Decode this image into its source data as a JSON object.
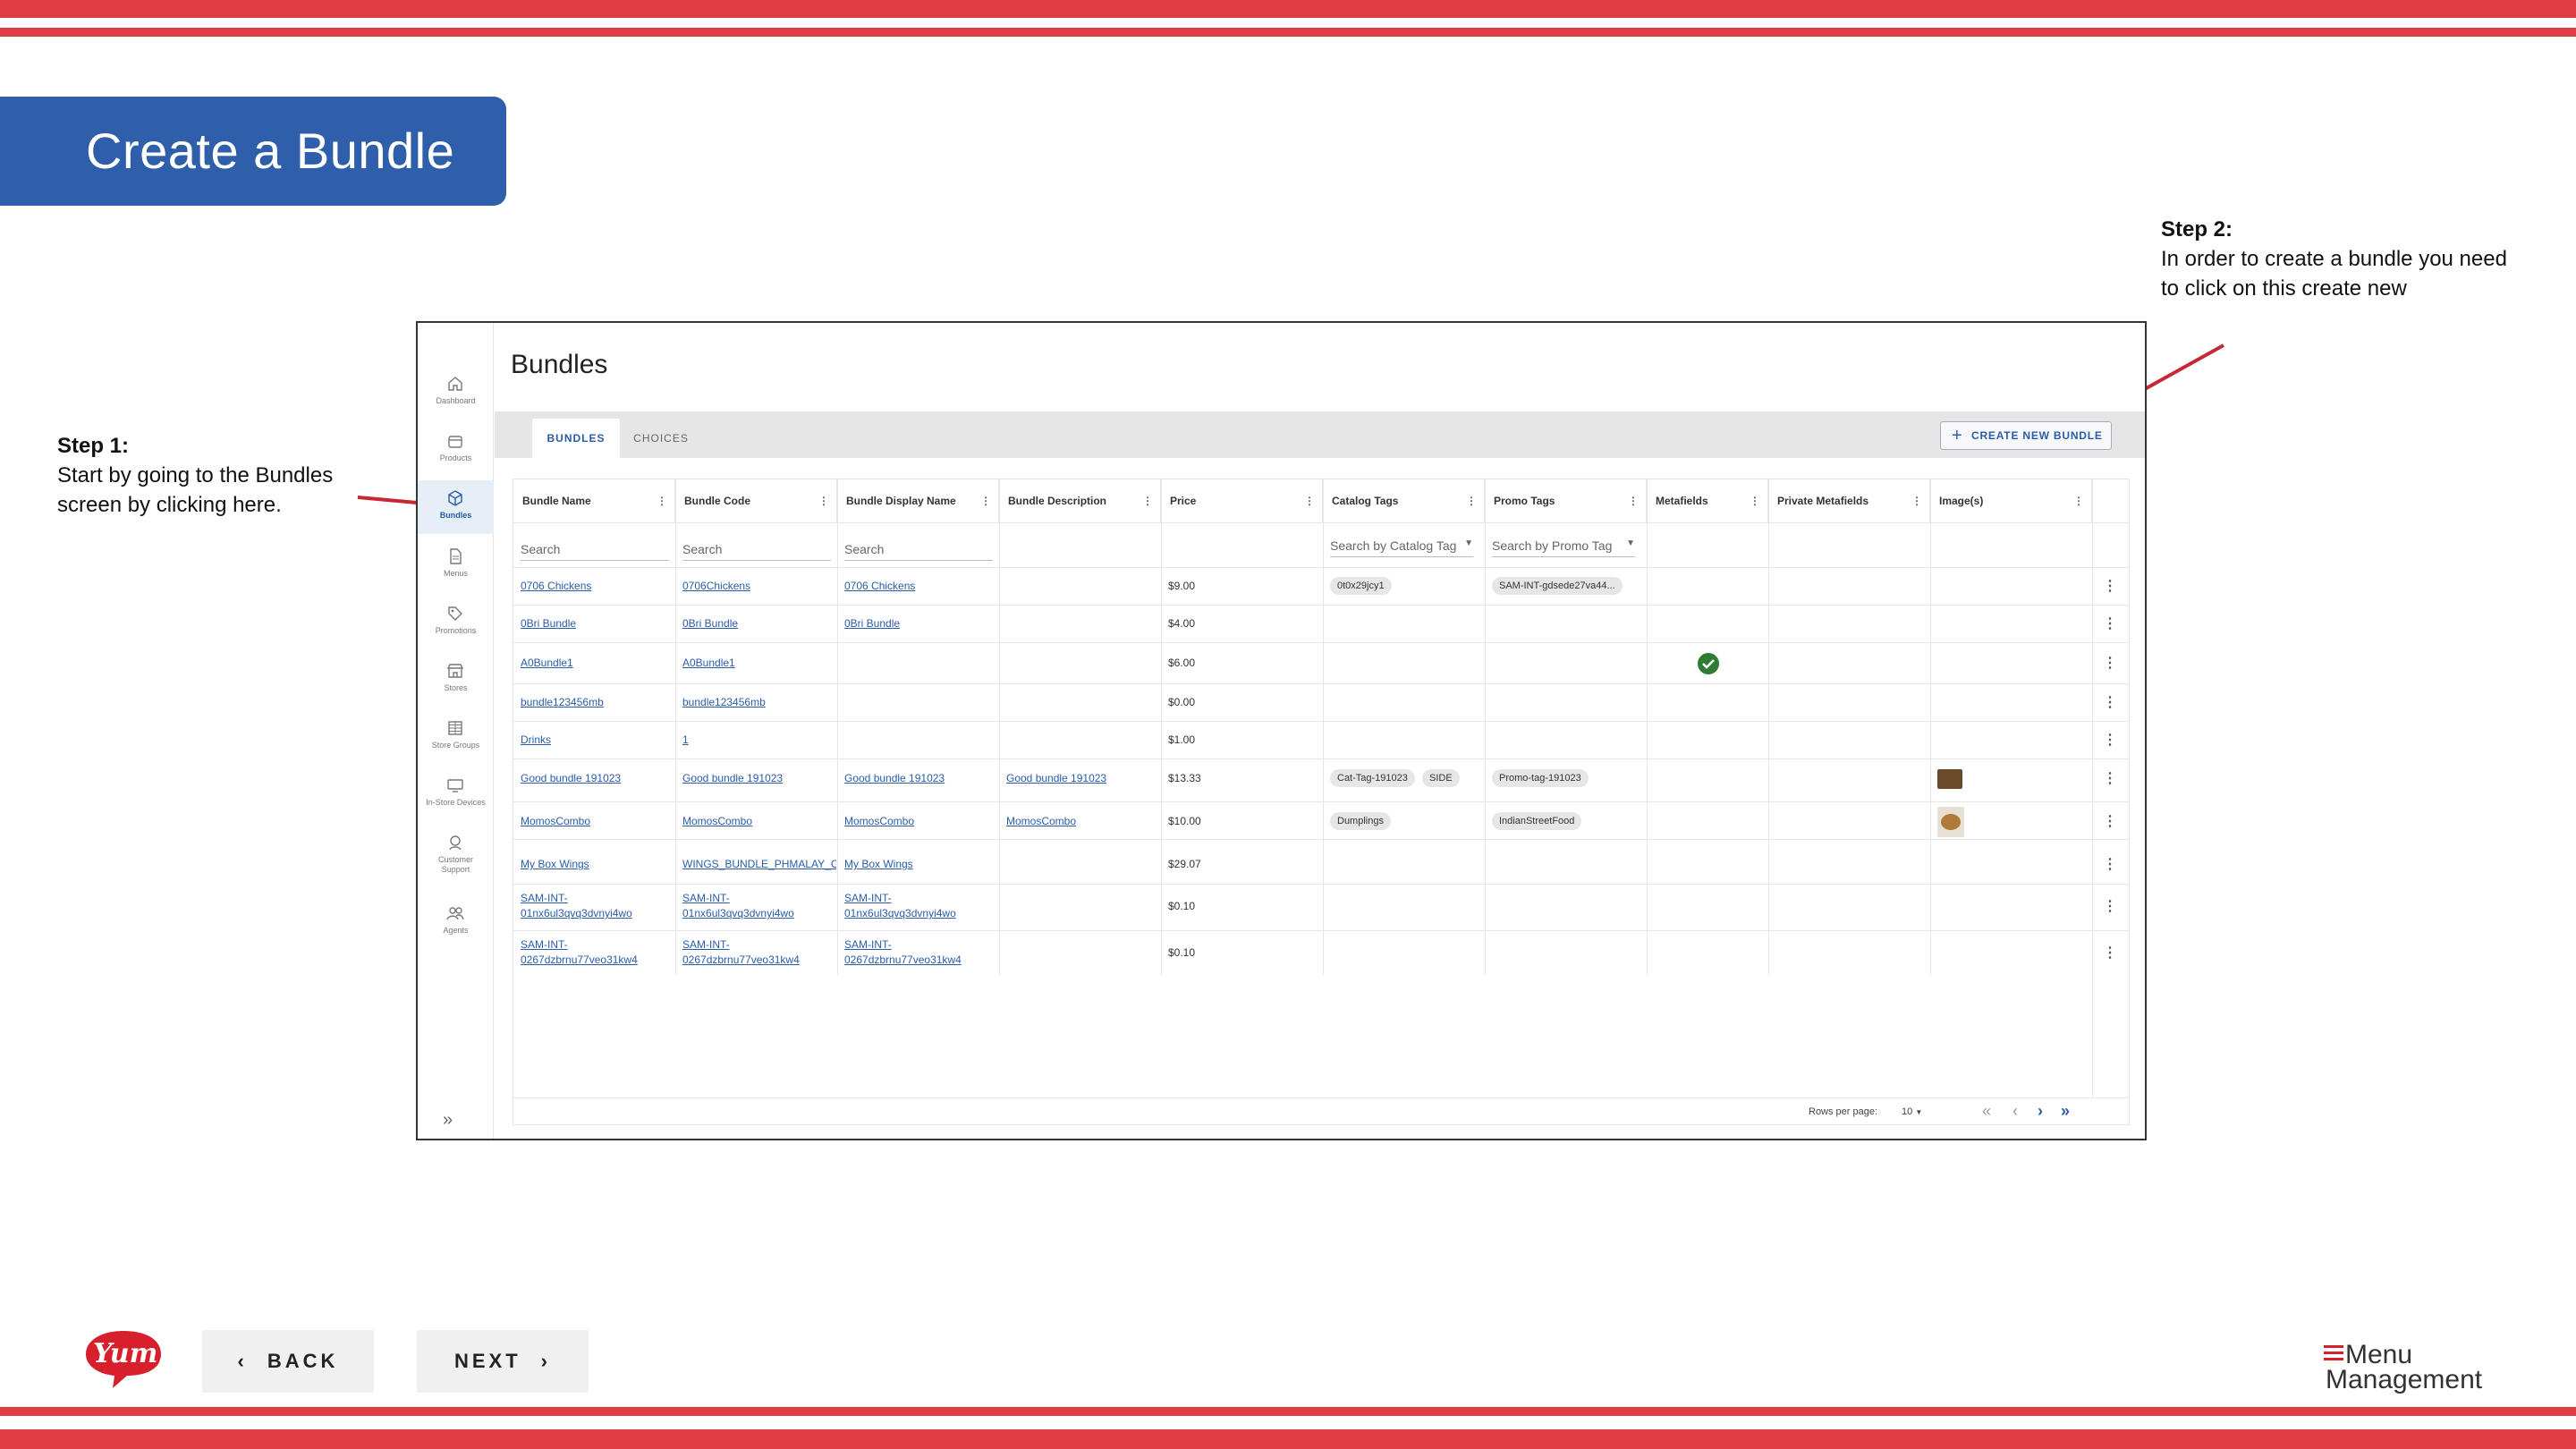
{
  "slide": {
    "title": "Create a Bundle",
    "step1": {
      "heading": "Step 1:",
      "text_line1": "Start by going to the Bundles",
      "text_line2": "screen by clicking here."
    },
    "step2": {
      "heading": "Step 2:",
      "text_line1": "In order to create a bundle you need",
      "text_line2": "to click on this create new"
    },
    "back_label": "BACK",
    "next_label": "NEXT",
    "brand_logo_text": "Yum!",
    "product_logo_line1": "Menu",
    "product_logo_line2": "Management",
    "colors": {
      "stripe": "#e03c44",
      "banner": "#2f5faa",
      "accent": "#2a5ca8",
      "arrow": "#c62836"
    }
  },
  "app": {
    "page_title": "Bundles",
    "sidebar": [
      {
        "label": "Dashboard",
        "icon": "home-icon"
      },
      {
        "label": "Products",
        "icon": "box-icon"
      },
      {
        "label": "Bundles",
        "icon": "cube-icon",
        "active": true
      },
      {
        "label": "Menus",
        "icon": "document-icon"
      },
      {
        "label": "Promotions",
        "icon": "tag-icon"
      },
      {
        "label": "Stores",
        "icon": "store-icon"
      },
      {
        "label": "Store Groups",
        "icon": "grid-icon"
      },
      {
        "label": "In-Store Devices",
        "icon": "monitor-icon"
      },
      {
        "label": "Customer Support",
        "label_line1": "Customer",
        "label_line2": "Support",
        "icon": "support-icon"
      },
      {
        "label": "Agents",
        "icon": "people-icon"
      }
    ],
    "tabs": {
      "bundles": "BUNDLES",
      "choices": "CHOICES"
    },
    "create_button": "CREATE NEW BUNDLE",
    "columns": [
      "Bundle Name",
      "Bundle Code",
      "Bundle Display Name",
      "Bundle Description",
      "Price",
      "Catalog Tags",
      "Promo Tags",
      "Metafields",
      "Private Metafields",
      "Image(s)"
    ],
    "filters": {
      "name": "Search",
      "code": "Search",
      "display": "Search",
      "catalog": "Search by Catalog Tag",
      "promo": "Search by Promo Tag"
    },
    "rows": [
      {
        "name": "0706 Chickens",
        "code": "0706Chickens",
        "display": "0706 Chickens",
        "desc": "",
        "price": "$9.00",
        "catalog": [
          "0t0x29jcy1"
        ],
        "promo": [
          "SAM-INT-gdsede27va44..."
        ]
      },
      {
        "name": "0Bri Bundle",
        "code": "0Bri Bundle",
        "display": "0Bri Bundle",
        "desc": "",
        "price": "$4.00",
        "catalog": [],
        "promo": []
      },
      {
        "name": "A0Bundle1",
        "code": "A0Bundle1",
        "display": "",
        "desc": "",
        "price": "$6.00",
        "catalog": [],
        "promo": [],
        "metafield_check": true
      },
      {
        "name": "bundle123456mb",
        "code": "bundle123456mb",
        "display": "",
        "desc": "",
        "price": "$0.00",
        "catalog": [],
        "promo": []
      },
      {
        "name": "Drinks",
        "code": "1",
        "display": "",
        "desc": "",
        "price": "$1.00",
        "catalog": [],
        "promo": []
      },
      {
        "name": "Good bundle 191023",
        "code": "Good bundle 191023",
        "display": "Good bundle 191023",
        "desc": "Good bundle 191023",
        "price": "$13.33",
        "catalog": [
          "Cat-Tag-191023",
          "SIDE"
        ],
        "promo": [
          "Promo-tag-191023"
        ],
        "image": "food-thumbnail"
      },
      {
        "name": "MomosCombo",
        "code": "MomosCombo",
        "display": "MomosCombo",
        "desc": "MomosCombo",
        "price": "$10.00",
        "catalog": [
          "Dumplings"
        ],
        "promo": [
          "IndianStreetFood"
        ],
        "image": "dumpling-thumbnail"
      },
      {
        "name": "My Box Wings",
        "code": "WINGS_BUNDLE_PHMALAY_C",
        "display": "My Box Wings",
        "desc": "",
        "price": "$29.07",
        "catalog": [],
        "promo": []
      },
      {
        "name_line1": "SAM-INT-",
        "name_line2": "01nx6ul3qvq3dvnyi4wo",
        "code_line1": "SAM-INT-",
        "code_line2": "01nx6ul3qvq3dvnyi4wo",
        "display_line1": "SAM-INT-",
        "display_line2": "01nx6ul3qvq3dvnyi4wo",
        "price": "$0.10"
      },
      {
        "name_line1": "SAM-INT-",
        "name_line2": "0267dzbrnu77veo31kw4",
        "code_line1": "SAM-INT-",
        "code_line2": "0267dzbrnu77veo31kw4",
        "display_line1": "SAM-INT-",
        "display_line2": "0267dzbrnu77veo31kw4",
        "price": "$0.10"
      }
    ],
    "pagination": {
      "rows_per_page_label": "Rows per page:",
      "rows_per_page": "10"
    }
  }
}
